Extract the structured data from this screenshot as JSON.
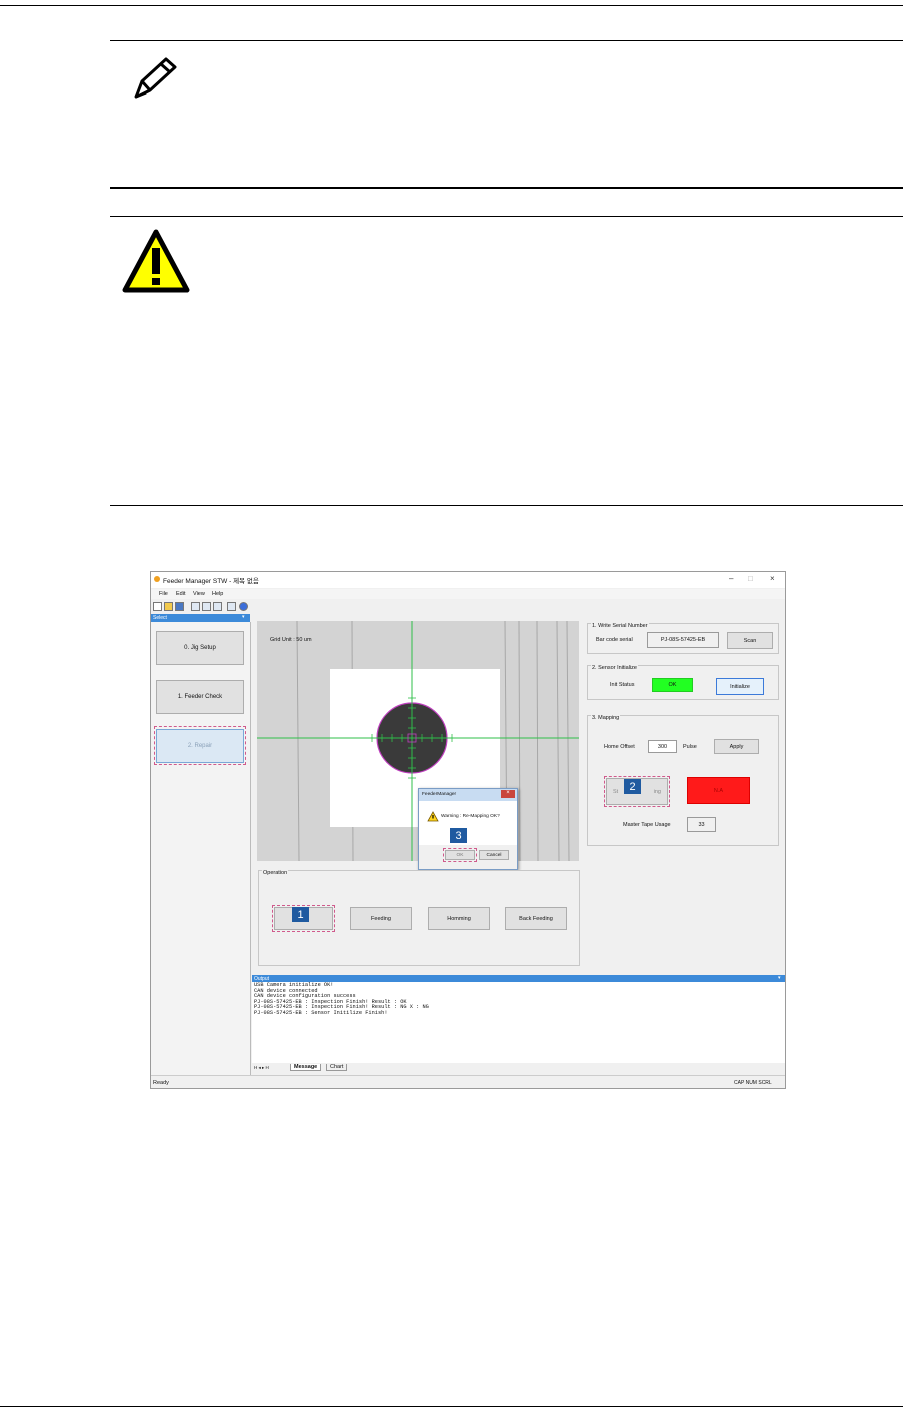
{
  "window": {
    "title": "Feeder Manager STW - 제목 없음",
    "menu": [
      "File",
      "Edit",
      "View",
      "Help"
    ]
  },
  "left_panel": {
    "header": "Select",
    "buttons": [
      "0. Jig Setup",
      "1. Feeder Check",
      "2. Repair"
    ]
  },
  "camera": {
    "grid_unit": "Grid Unit : 50 um"
  },
  "dialog": {
    "title": "FeederManager",
    "message": "Warning : Re-Mapping OK?",
    "ok": "OK",
    "cancel": "Cancel"
  },
  "operation": {
    "title": "Operation",
    "buttons": [
      "",
      "Feeding",
      "Homming",
      "Back Feeding"
    ]
  },
  "serial": {
    "title": "1. Write Serial Number",
    "label": "Bar code serial",
    "value": "PJ-08S-57425-EB",
    "scan": "Scan"
  },
  "sensor": {
    "title": "2. Sensor Initialize",
    "label": "Init Status",
    "status": "OK",
    "button": "Initialize"
  },
  "mapping": {
    "title": "3. Mapping",
    "offset_label": "Home Offset",
    "offset_value": "300",
    "unit": "Pulse",
    "apply": "Apply",
    "start_left": "St",
    "start_right": "ing",
    "result": "N.A",
    "usage_label": "Master Tape Usage",
    "usage_value": "33"
  },
  "output": {
    "header": "Output",
    "lines": [
      "USB Camera initialize OK!",
      "CAN device connected",
      "CAN device configuration success",
      "PJ-08S-57425-EB  : Inspection Finish!   Result : OK",
      "PJ-08S-57425-EB  : Inspection Finish!   Result : NG   X : NG",
      "PJ-08S-57425-EB  : Sensor Initilize Finish!"
    ]
  },
  "tabs": {
    "nav": "H ◂ ▸ H",
    "message": "Message",
    "chart": "Chart"
  },
  "status": {
    "left": "Ready",
    "right": "CAP  NUM  SCRL"
  },
  "callouts": [
    "1",
    "2",
    "3"
  ],
  "colors": {
    "ok_green": "#22ff22",
    "na_red": "#ff1a1a",
    "callout_blue": "#1f5aa0",
    "accent_blue": "#3c8ad9"
  }
}
